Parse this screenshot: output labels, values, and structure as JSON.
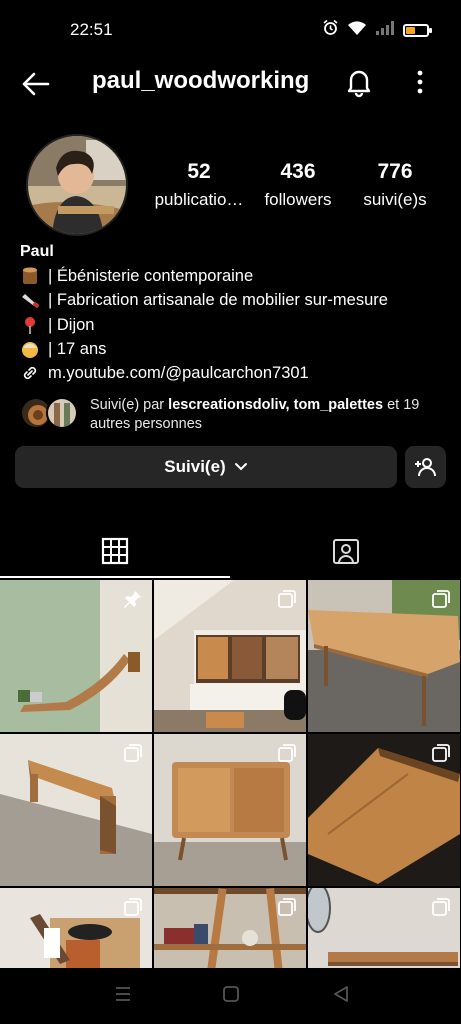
{
  "status_bar": {
    "time": "22:51"
  },
  "header": {
    "username": "paul_woodworking"
  },
  "stats": [
    {
      "value": "52",
      "label": "publicatio…"
    },
    {
      "value": "436",
      "label": "followers"
    },
    {
      "value": "776",
      "label": "suivi(e)s"
    }
  ],
  "bio": {
    "name": "Paul",
    "lines": [
      {
        "emoji": "wood-icon",
        "text": "| Ébénisterie contemporaine"
      },
      {
        "emoji": "saw-icon",
        "text": "| Fabrication artisanale de mobilier sur-mesure"
      },
      {
        "emoji": "pin-icon",
        "text": "| Dijon"
      },
      {
        "emoji": "person-icon",
        "text": "| 17 ans"
      }
    ],
    "link": "m.youtube.com/@paulcarchon7301"
  },
  "followed_by": {
    "prefix": "Suivi(e) par ",
    "names": "lescreationsdoliv, tom_palettes",
    "suffix": " et 19 autres personnes"
  },
  "actions": {
    "follow_label": "Suivi(e)"
  },
  "colors": {
    "button_bg": "#262626",
    "battery": "#f5a623",
    "background": "#000000"
  }
}
